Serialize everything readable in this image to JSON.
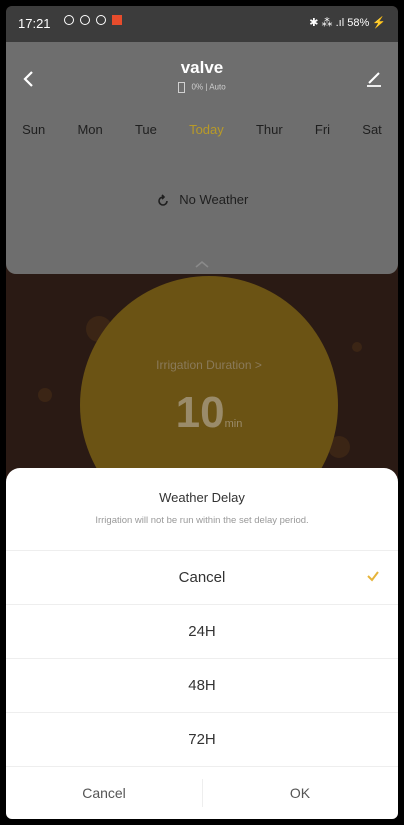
{
  "status_bar": {
    "time": "17:21",
    "right": "✱ ⁂ .ıl 58% ⚡"
  },
  "header": {
    "title": "valve",
    "battery_level": "0%",
    "mode": "| Auto"
  },
  "days": [
    "Sun",
    "Mon",
    "Tue",
    "Today",
    "Thur",
    "Fri",
    "Sat"
  ],
  "weather": {
    "label": "No Weather"
  },
  "duration": {
    "label": "Irrigation Duration >",
    "value": "10",
    "unit": "min"
  },
  "sheet": {
    "title": "Weather Delay",
    "description": "Irrigation will not be run within the set delay period.",
    "options": [
      "Cancel",
      "24H",
      "48H",
      "72H"
    ],
    "selected": "Cancel",
    "cancel_label": "Cancel",
    "ok_label": "OK"
  },
  "colors": {
    "accent": "#e6b43a",
    "today": "#b89a28",
    "circle": "#6b5314"
  }
}
